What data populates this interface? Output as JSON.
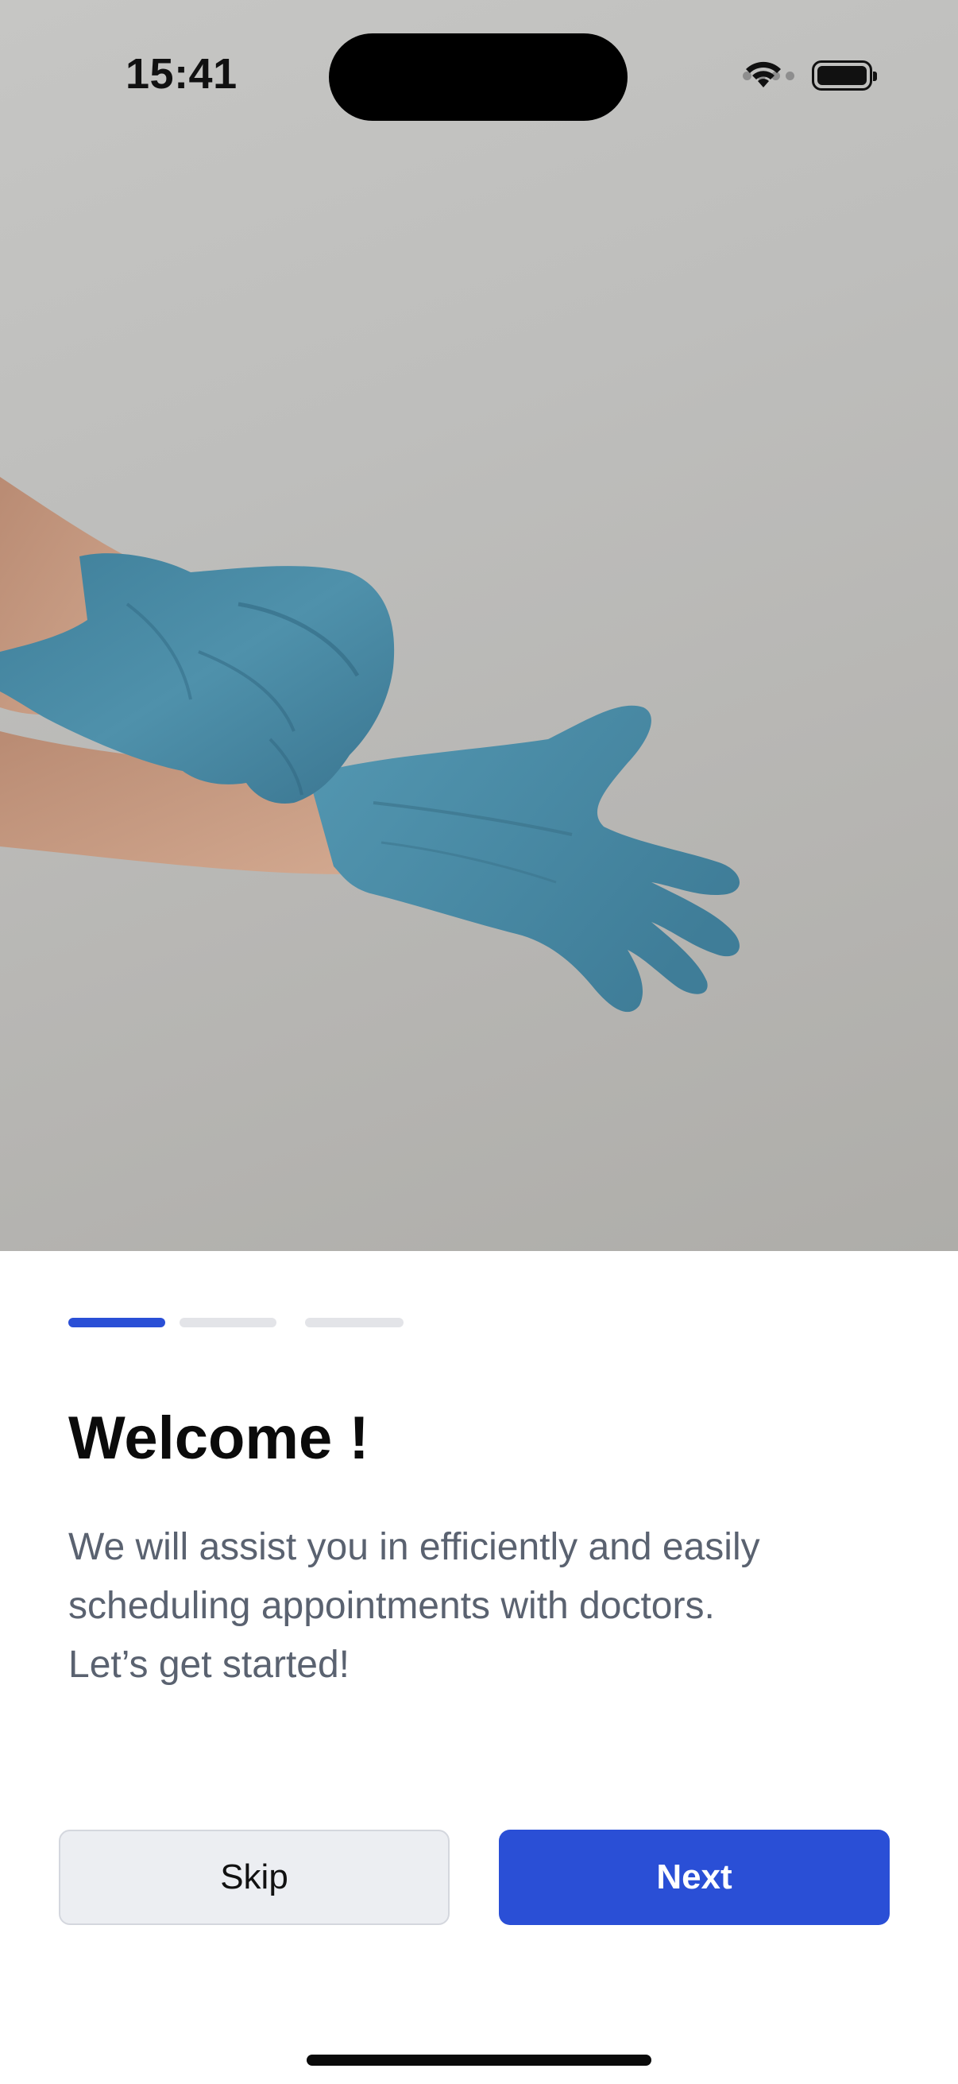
{
  "status_bar": {
    "time": "15:41",
    "icons": [
      "cellular-signal-icon",
      "wifi-icon",
      "battery-icon"
    ]
  },
  "hero": {
    "image": "gloved-hands-photo"
  },
  "onboarding": {
    "step_current": 1,
    "step_total": 3,
    "title": "Welcome !",
    "description": "We will assist you in efficiently and easily\nscheduling appointments with doctors.\n Let’s get started!"
  },
  "actions": {
    "skip_label": "Skip",
    "next_label": "Next"
  },
  "colors": {
    "accent": "#2a4fd6",
    "inactive_segment": "#e3e4e8",
    "glove": "#4b8ba4",
    "skin": "#c59a82"
  }
}
